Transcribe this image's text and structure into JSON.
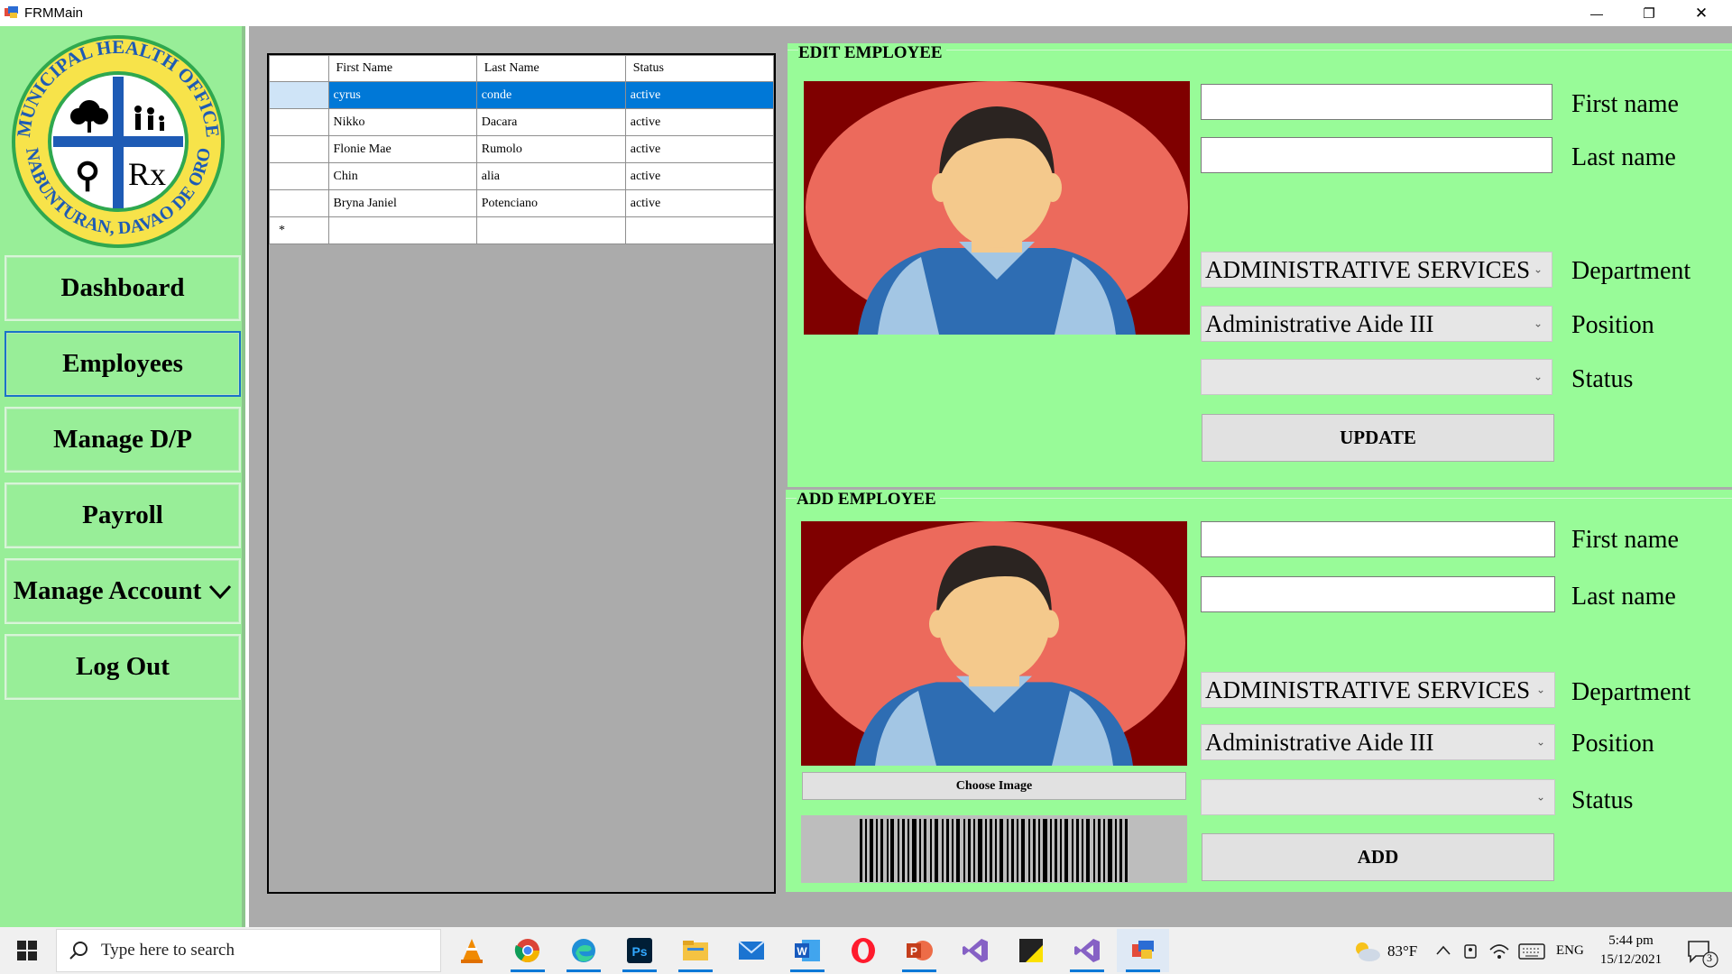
{
  "window": {
    "title": "FRMMain",
    "minimize_glyph": "—",
    "restore_glyph": "❐",
    "close_glyph": "✕"
  },
  "logo": {
    "ring_text_top": "MUNICIPAL HEALTH OFFICE",
    "ring_text_bottom": "NABUNTURAN, DAVAO DE ORO",
    "rx": "Rx",
    "colors": {
      "ring": "#1e5bb5",
      "fill": "#ffffff",
      "accent": "#2fa84f"
    }
  },
  "sidebar": {
    "items": [
      {
        "label": "Dashboard"
      },
      {
        "label": "Employees"
      },
      {
        "label": "Manage D/P"
      },
      {
        "label": "Payroll"
      },
      {
        "label": "Manage Account",
        "chevron": "chevron-down"
      },
      {
        "label": "Log Out"
      }
    ],
    "active_index": 1
  },
  "grid": {
    "columns": [
      "First Name",
      "Last Name",
      "Status"
    ],
    "rows": [
      {
        "first": "cyrus",
        "last": "conde",
        "status": "active",
        "selected": true
      },
      {
        "first": "Nikko",
        "last": "Dacara",
        "status": "active"
      },
      {
        "first": "Flonie Mae",
        "last": "Rumolo",
        "status": "active"
      },
      {
        "first": "Chin",
        "last": "alia",
        "status": "active"
      },
      {
        "first": "Bryna Janiel",
        "last": "Potenciano",
        "status": "active"
      }
    ],
    "new_row_marker": "*"
  },
  "edit": {
    "title": "EDIT EMPLOYEE",
    "first_name_label": "First name",
    "last_name_label": "Last name",
    "first_name_value": "",
    "last_name_value": "",
    "department_label": "Department",
    "department_value": "ADMINISTRATIVE SERVICES",
    "position_label": "Position",
    "position_value": "Administrative Aide III",
    "status_label": "Status",
    "status_value": "",
    "update_button": "UPDATE"
  },
  "add": {
    "title": "ADD EMPLOYEE",
    "first_name_label": "First name",
    "last_name_label": "Last name",
    "first_name_value": "",
    "last_name_value": "",
    "department_label": "Department",
    "department_value": "ADMINISTRATIVE SERVICES",
    "position_label": "Position",
    "position_value": "Administrative Aide III",
    "status_label": "Status",
    "status_value": "",
    "choose_image_button": "Choose Image",
    "add_button": "ADD"
  },
  "taskbar": {
    "search_placeholder": "Type here to search",
    "apps": [
      "vlc-icon",
      "chrome-icon",
      "edge-icon",
      "photoshop-icon",
      "file-explorer-icon",
      "mail-icon",
      "word-icon",
      "opera-icon",
      "powerpoint-icon",
      "visual-studio-icon",
      "sticky-notes-icon",
      "visual-studio-icon",
      "frmmain-app-icon"
    ],
    "weather": "83°F",
    "language": "ENG",
    "time": "5:44 pm",
    "date": "15/12/2021",
    "notification_count": "3"
  },
  "colors": {
    "sidebar_bg": "#98ee98",
    "panel_bg": "#98fb98",
    "main_bg": "#ababab",
    "selection": "#0078d7",
    "photo_bg": "#7f0000"
  }
}
